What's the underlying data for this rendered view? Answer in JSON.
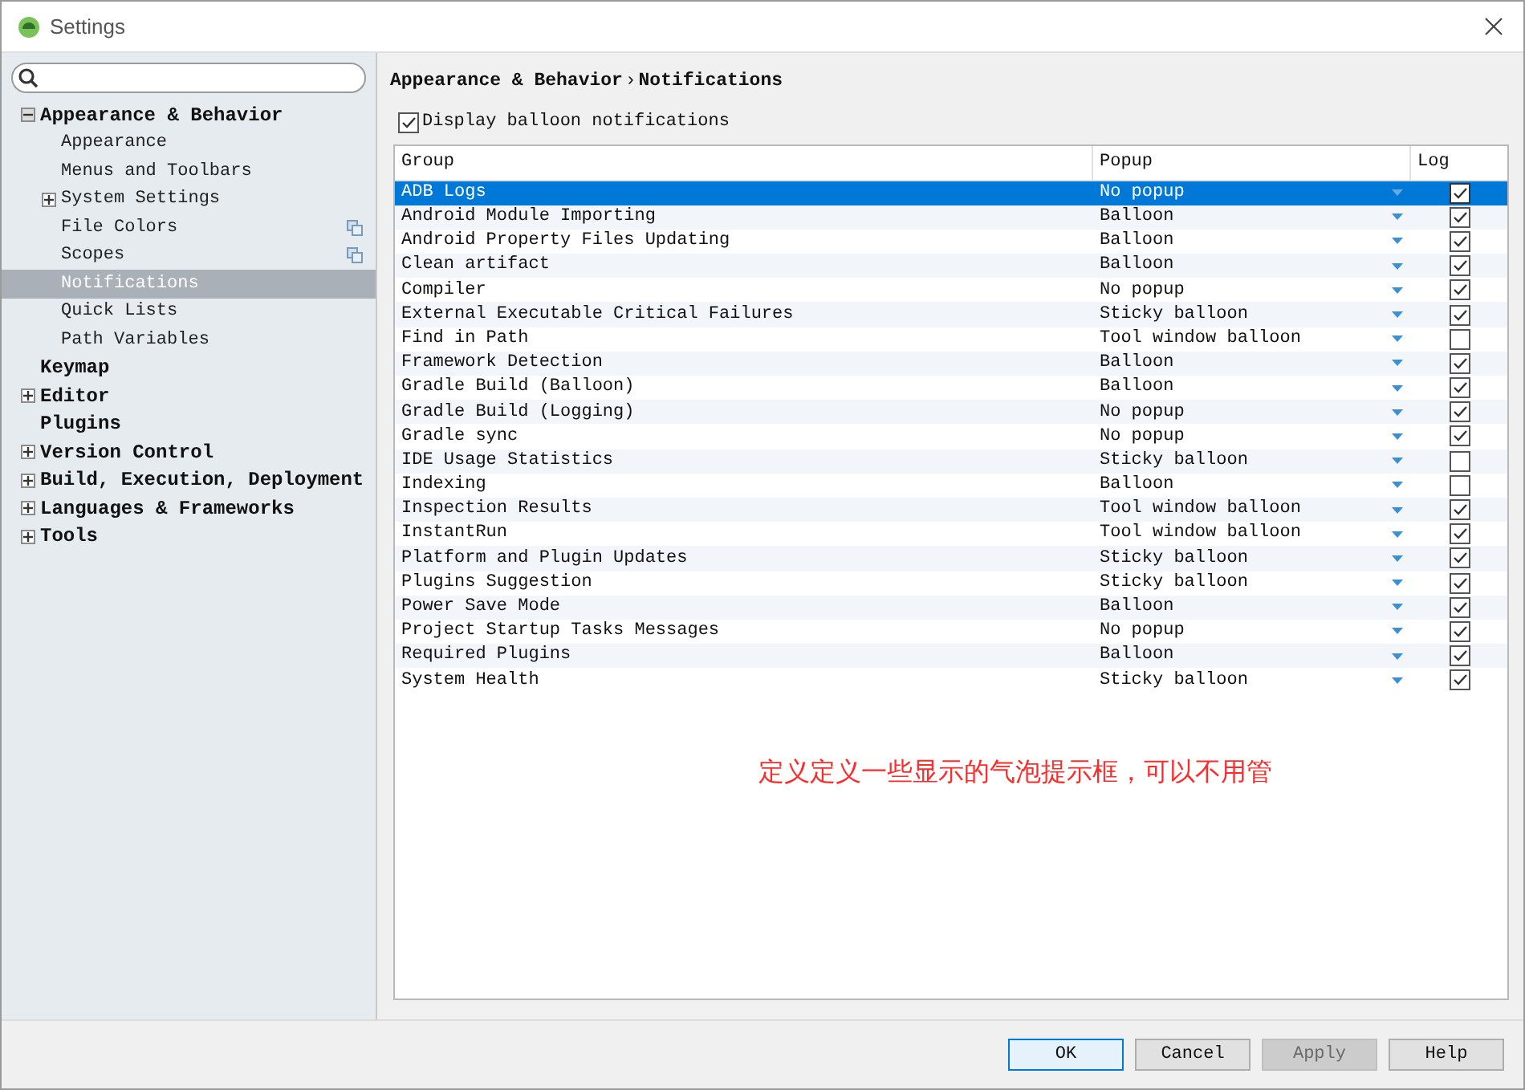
{
  "window": {
    "title": "Settings"
  },
  "sidebar": {
    "items": [
      {
        "label": "Appearance & Behavior",
        "expanded": true,
        "selected": false,
        "children": [
          {
            "label": "Appearance",
            "selected": false
          },
          {
            "label": "Menus and Toolbars",
            "selected": false
          },
          {
            "label": "System Settings",
            "expanded": false,
            "selected": false
          },
          {
            "label": "File Colors",
            "project_level": true,
            "selected": false
          },
          {
            "label": "Scopes",
            "project_level": true,
            "selected": false
          },
          {
            "label": "Notifications",
            "selected": true
          },
          {
            "label": "Quick Lists",
            "selected": false
          },
          {
            "label": "Path Variables",
            "selected": false
          }
        ]
      },
      {
        "label": "Keymap",
        "selected": false
      },
      {
        "label": "Editor",
        "expanded": false,
        "selected": false
      },
      {
        "label": "Plugins",
        "selected": false
      },
      {
        "label": "Version Control",
        "expanded": false,
        "selected": false
      },
      {
        "label": "Build, Execution, Deployment",
        "expanded": false,
        "selected": false
      },
      {
        "label": "Languages & Frameworks",
        "expanded": false,
        "selected": false
      },
      {
        "label": "Tools",
        "expanded": false,
        "selected": false
      }
    ]
  },
  "breadcrumb": {
    "parent": "Appearance & Behavior",
    "separator": "›",
    "current": "Notifications"
  },
  "display_balloon": {
    "label": "Display balloon notifications",
    "checked": true
  },
  "table": {
    "columns": [
      "Group",
      "Popup",
      "Log"
    ],
    "rows": [
      {
        "group": "ADB Logs",
        "popup": "No popup",
        "log": true,
        "selected": true
      },
      {
        "group": "Android Module Importing",
        "popup": "Balloon",
        "log": true,
        "selected": false
      },
      {
        "group": "Android Property Files Updating",
        "popup": "Balloon",
        "log": true,
        "selected": false
      },
      {
        "group": "Clean artifact",
        "popup": "Balloon",
        "log": true,
        "selected": false
      },
      {
        "group": "Compiler",
        "popup": "No popup",
        "log": true,
        "selected": false
      },
      {
        "group": "External Executable Critical Failures",
        "popup": "Sticky balloon",
        "log": true,
        "selected": false
      },
      {
        "group": "Find in Path",
        "popup": "Tool window balloon",
        "log": false,
        "selected": false
      },
      {
        "group": "Framework Detection",
        "popup": "Balloon",
        "log": true,
        "selected": false
      },
      {
        "group": "Gradle Build (Balloon)",
        "popup": "Balloon",
        "log": true,
        "selected": false
      },
      {
        "group": "Gradle Build (Logging)",
        "popup": "No popup",
        "log": true,
        "selected": false
      },
      {
        "group": "Gradle sync",
        "popup": "No popup",
        "log": true,
        "selected": false
      },
      {
        "group": "IDE Usage Statistics",
        "popup": "Sticky balloon",
        "log": false,
        "selected": false
      },
      {
        "group": "Indexing",
        "popup": "Balloon",
        "log": false,
        "selected": false
      },
      {
        "group": "Inspection Results",
        "popup": "Tool window balloon",
        "log": true,
        "selected": false
      },
      {
        "group": "InstantRun",
        "popup": "Tool window balloon",
        "log": true,
        "selected": false
      },
      {
        "group": "Platform and Plugin Updates",
        "popup": "Sticky balloon",
        "log": true,
        "selected": false
      },
      {
        "group": "Plugins Suggestion",
        "popup": "Sticky balloon",
        "log": true,
        "selected": false
      },
      {
        "group": "Power Save Mode",
        "popup": "Balloon",
        "log": true,
        "selected": false
      },
      {
        "group": "Project Startup Tasks Messages",
        "popup": "No popup",
        "log": true,
        "selected": false
      },
      {
        "group": "Required Plugins",
        "popup": "Balloon",
        "log": true,
        "selected": false
      },
      {
        "group": "System Health",
        "popup": "Sticky balloon",
        "log": true,
        "selected": false
      }
    ]
  },
  "annotation": "定义定义一些显示的气泡提示框，可以不用管",
  "buttons": [
    {
      "label": "OK",
      "default": true,
      "disabled": false
    },
    {
      "label": "Cancel",
      "default": false,
      "disabled": false
    },
    {
      "label": "Apply",
      "default": false,
      "disabled": true
    },
    {
      "label": "Help",
      "default": false,
      "disabled": false
    }
  ]
}
